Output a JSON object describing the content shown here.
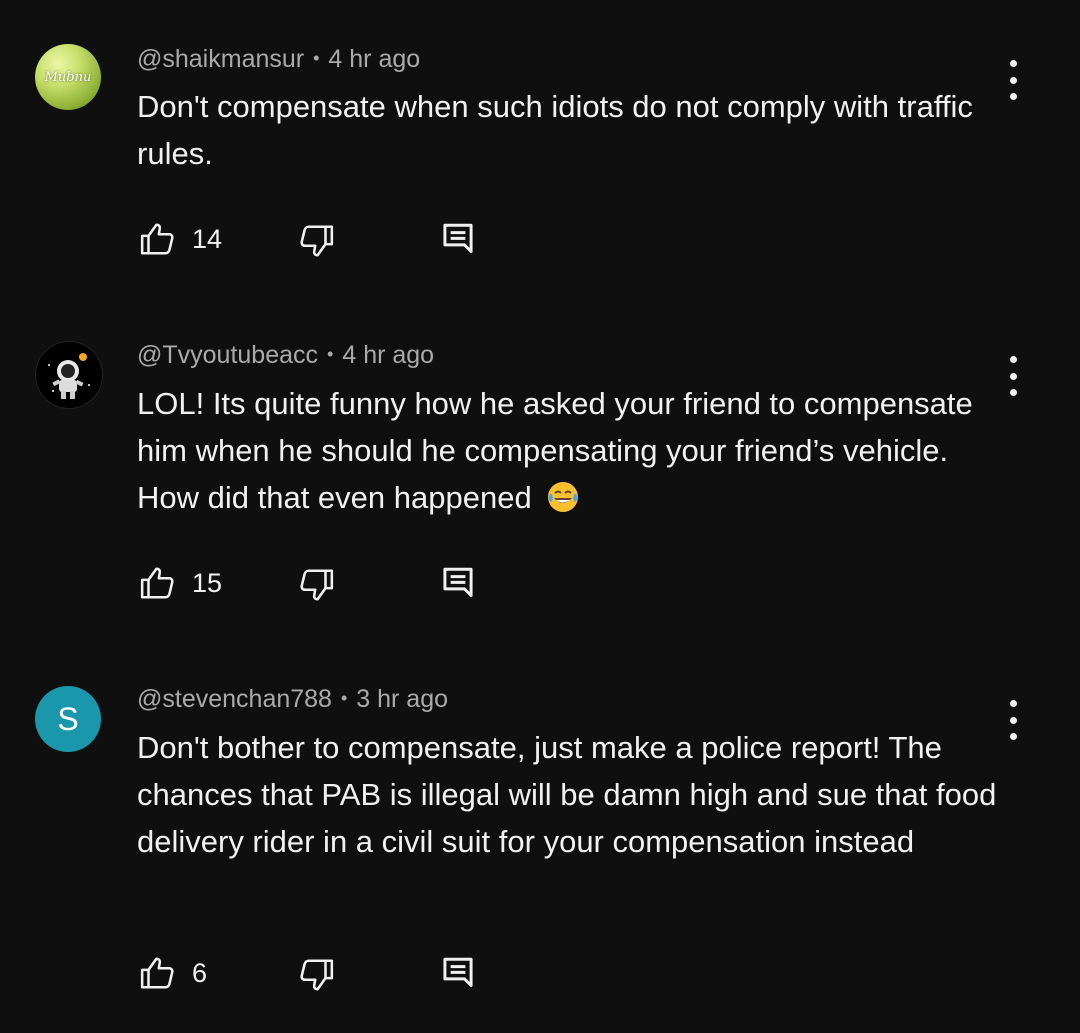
{
  "comments": [
    {
      "author": "@shaikmansur",
      "time": "4 hr ago",
      "text": "Don't compensate when such idiots do not comply with traffic rules.",
      "likes": "14",
      "avatar_text": "Mubnu"
    },
    {
      "author": "@Tvyoutubeacc",
      "time": "4 hr ago",
      "text": "LOL! Its quite funny how he asked your friend to compensate him when he should he compensating your friend’s vehicle. How did that even happened",
      "emoji": "tears-of-joy-emoji",
      "likes": "15"
    },
    {
      "author": "@stevenchan788",
      "time": "3 hr ago",
      "text": "Don't bother to compensate, just make a police report! The chances that PAB is illegal will be damn high and sue that food delivery rider in a civil suit for your compensation instead",
      "likes": "6",
      "avatar_letter": "S"
    }
  ],
  "separator": "•",
  "icons": [
    "like-icon",
    "dislike-icon",
    "reply-icon",
    "more-vert-icon"
  ],
  "colors": {
    "background": "#0f0f0f",
    "text": "#f1f1f1",
    "meta": "#aaaaaa",
    "avatar_s": "#1a97aa"
  }
}
